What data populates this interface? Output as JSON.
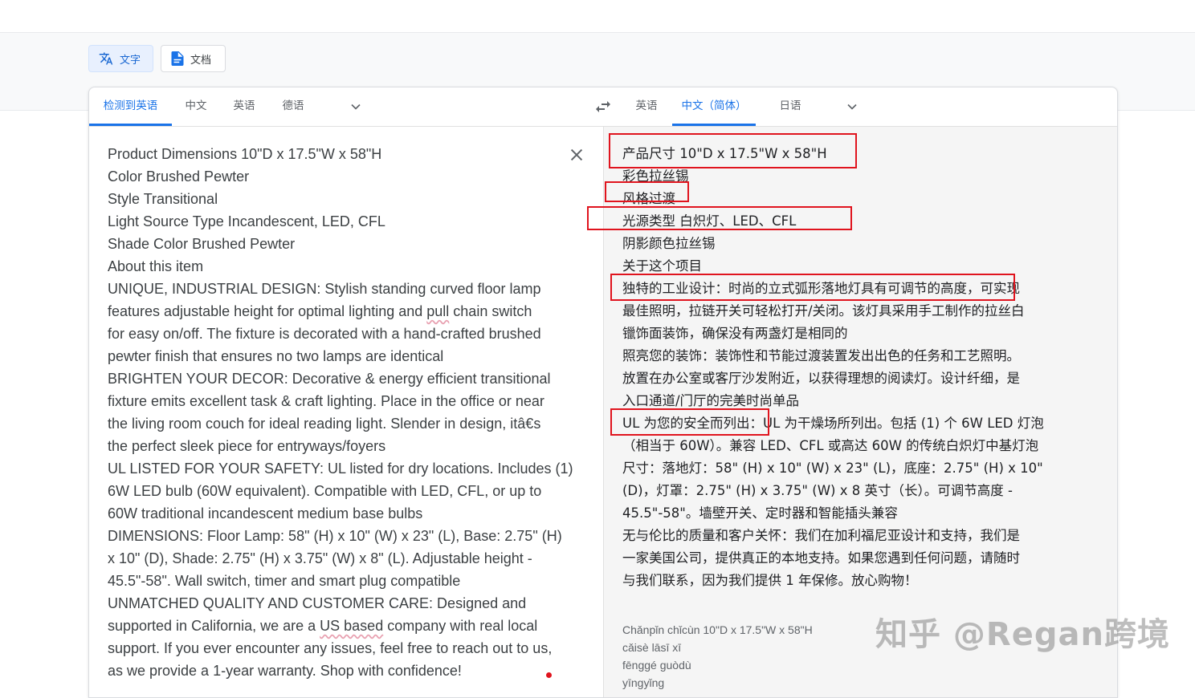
{
  "modes": {
    "text_label": "文字",
    "docs_label": "文档"
  },
  "source_langs": [
    "检测到英语",
    "中文",
    "英语",
    "德语"
  ],
  "target_langs": [
    "英语",
    "中文（简体）",
    "日语"
  ],
  "source_lines": [
    "Product Dimensions    10\"D x 17.5\"W x 58\"H",
    "Color      Brushed Pewter",
    "Style       Transitional",
    "Light Source Type       Incandescent, LED, CFL",
    "Shade Color  Brushed Pewter",
    "About this item",
    "UNIQUE, INDUSTRIAL DESIGN: Stylish standing curved floor lamp",
    "features adjustable height for optimal lighting and ",
    "for easy on/off. The fixture is decorated with a hand-crafted brushed",
    "pewter finish that ensures no two lamps are identical",
    "BRIGHTEN YOUR DECOR: Decorative & energy efficient transitional",
    "fixture emits excellent task & craft lighting. Place in the office or near",
    "the living room couch for ideal reading light. Slender in design, itâ€s",
    "the perfect sleek piece for entryways/foyers",
    "UL LISTED FOR YOUR SAFETY: UL listed for dry locations. Includes (1)",
    "6W LED bulb (60W equivalent). Compatible with LED, CFL, or up to",
    "60W traditional incandescent medium base bulbs",
    "DIMENSIONS: Floor Lamp: 58\" (H) x 10\" (W) x 23\" (L), Base: 2.75\" (H)",
    "x 10\" (D), Shade: 2.75\" (H) x 3.75\" (W) x 8\" (L). Adjustable height -",
    "45.5\"-58\". Wall switch, timer and smart plug compatible",
    "UNMATCHED QUALITY AND CUSTOMER CARE: Designed and",
    "supported in California, we are a ",
    "support. If you ever encounter any issues, feel free to reach out to us,",
    "as we provide a 1-year warranty. Shop with confidence!"
  ],
  "source_marked": {
    "pull": "pull",
    "pull_rest": " chain switch",
    "us_based": "US based",
    "us_rest": " company with real local"
  },
  "target_lines": [
    "产品尺寸 10\"D x 17.5\"W x 58\"H",
    "彩色拉丝锡",
    "风格过渡",
    "光源类型 白炽灯、LED、CFL",
    "阴影颜色拉丝锡",
    "关于这个项目",
    "独特的工业设计：时尚的立式弧形落地灯具有可调节的高度，可实现",
    "最佳照明，拉链开关可轻松打开/关闭。该灯具采用手工制作的拉丝白",
    "镴饰面装饰，确保没有两盏灯是相同的",
    "照亮您的装饰：装饰性和节能过渡装置发出出色的任务和工艺照明。",
    "放置在办公室或客厅沙发附近，以获得理想的阅读灯。设计纤细，是",
    "入口通道/门厅的完美时尚单品",
    "UL 为您的安全而列出：UL 为干燥场所列出。包括 (1) 个 6W LED 灯泡",
    "（相当于 60W）。兼容 LED、CFL 或高达 60W 的传统白炽灯中基灯泡",
    "尺寸：落地灯：58\" (H) x 10\" (W) x 23\" (L)，底座：2.75\" (H) x 10\"",
    "(D)，灯罩：2.75\" (H) x 3.75\" (W) x 8 英寸（长）。可调节高度 -",
    "45.5\"-58\"。墙壁开关、定时器和智能插头兼容",
    "无与伦比的质量和客户关怀：我们在加利福尼亚设计和支持，我们是",
    "一家美国公司，提供真正的本地支持。如果您遇到任何问题，请随时",
    "与我们联系，因为我们提供 1 年保修。放心购物！"
  ],
  "romanization": [
    "Chǎnpǐn chǐcùn 10\"D x 17.5\"W x 58\"H",
    "cǎisè lāsī xī",
    "fēnggé guòdù",
    "yīngyǐng"
  ],
  "watermark": "知乎 @Regan跨境",
  "colors": {
    "accent": "#1a73e8",
    "highlight_box": "#e0141e"
  }
}
